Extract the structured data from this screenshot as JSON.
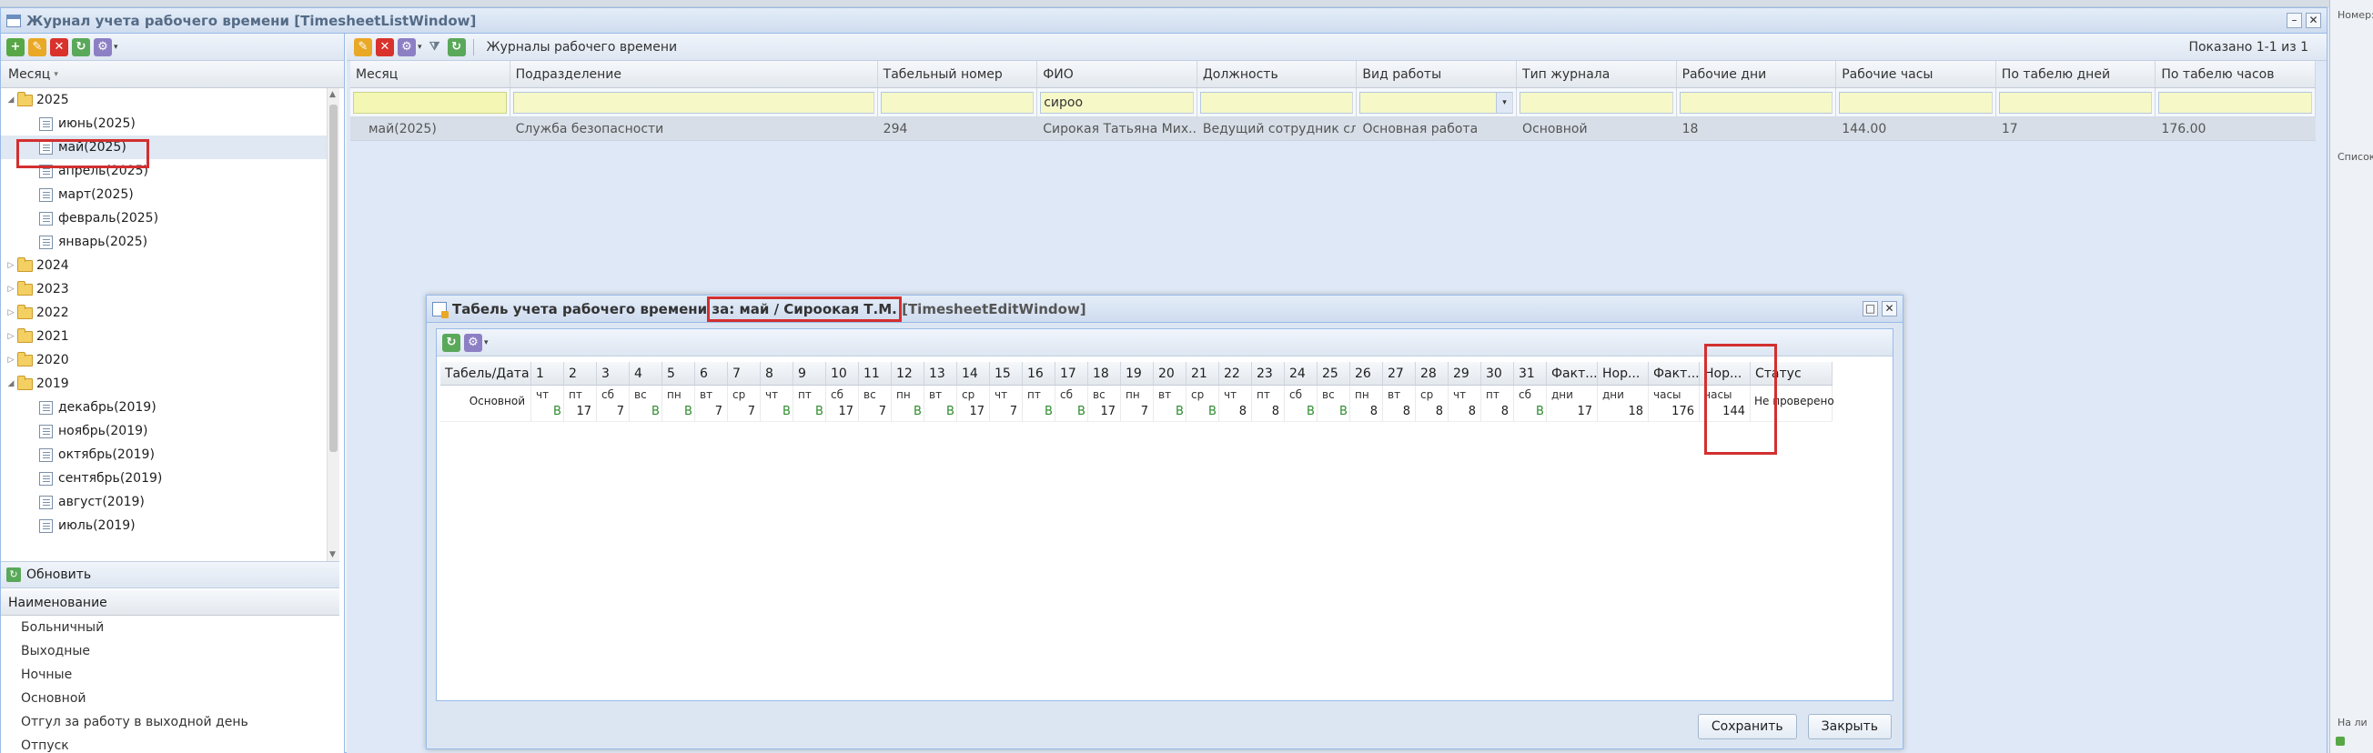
{
  "main_window": {
    "title": "Журнал учета рабочего времени [TimesheetListWindow]"
  },
  "left_panel": {
    "column_header": "Месяц",
    "tree": [
      {
        "label": "2025",
        "type": "year",
        "expanded": true
      },
      {
        "label": "июнь(2025)",
        "type": "month"
      },
      {
        "label": "май(2025)",
        "type": "month",
        "selected": true
      },
      {
        "label": "апрель(2025)",
        "type": "month"
      },
      {
        "label": "март(2025)",
        "type": "month"
      },
      {
        "label": "февраль(2025)",
        "type": "month"
      },
      {
        "label": "январь(2025)",
        "type": "month"
      },
      {
        "label": "2024",
        "type": "year",
        "expanded": false
      },
      {
        "label": "2023",
        "type": "year",
        "expanded": false
      },
      {
        "label": "2022",
        "type": "year",
        "expanded": false
      },
      {
        "label": "2021",
        "type": "year",
        "expanded": false
      },
      {
        "label": "2020",
        "type": "year",
        "expanded": false
      },
      {
        "label": "2019",
        "type": "year",
        "expanded": true
      },
      {
        "label": "декабрь(2019)",
        "type": "month"
      },
      {
        "label": "ноябрь(2019)",
        "type": "month"
      },
      {
        "label": "октябрь(2019)",
        "type": "month"
      },
      {
        "label": "сентябрь(2019)",
        "type": "month"
      },
      {
        "label": "август(2019)",
        "type": "month"
      },
      {
        "label": "июль(2019)",
        "type": "month"
      }
    ],
    "refresh_label": "Обновить",
    "names_header": "Наименование",
    "names": [
      "Больничный",
      "Выходные",
      "Ночные",
      "Основной",
      "Отгул за работу в выходной день",
      "Отпуск"
    ]
  },
  "right_panel": {
    "toolbar_label": "Журналы рабочего времени",
    "shown": "Показано 1-1 из 1",
    "columns": [
      "Месяц",
      "Подразделение",
      "Табельный номер",
      "ФИО",
      "Должность",
      "Вид работы",
      "Тип журнала",
      "Рабочие дни",
      "Рабочие часы",
      "По табелю дней",
      "По табелю часов"
    ],
    "filters": [
      "",
      "",
      "",
      "сироо",
      "",
      "",
      "",
      "",
      "",
      "",
      ""
    ],
    "rows": [
      [
        "май(2025)",
        "Служба безопасности",
        "294",
        "Сирокая Татьяна Мих...",
        "Ведущий сотрудник слу...",
        "Основная работа",
        "Основной",
        "18",
        "144.00",
        "17",
        "176.00"
      ]
    ]
  },
  "right_strip": {
    "label1": "Номер:",
    "label2": "Список",
    "label3": "На ли"
  },
  "modal": {
    "title_prefix": "Табель учета рабочего времени",
    "title_highlight": "за: май / Сироокая Т.М.",
    "title_suffix": "[TimesheetEditWindow]",
    "headers": [
      "Табель/Дата",
      "1",
      "2",
      "3",
      "4",
      "5",
      "6",
      "7",
      "8",
      "9",
      "10",
      "11",
      "12",
      "13",
      "14",
      "15",
      "16",
      "17",
      "18",
      "19",
      "20",
      "21",
      "22",
      "23",
      "24",
      "25",
      "26",
      "27",
      "28",
      "29",
      "30",
      "31",
      "Факт...",
      "Нор...",
      "Факт...",
      "Нор...",
      "Статус"
    ],
    "row_label": "Основной",
    "days": [
      {
        "wd": "чт",
        "v": "В"
      },
      {
        "wd": "пт",
        "v": "17"
      },
      {
        "wd": "сб",
        "v": "7"
      },
      {
        "wd": "вс",
        "v": "В"
      },
      {
        "wd": "пн",
        "v": "В"
      },
      {
        "wd": "вт",
        "v": "7"
      },
      {
        "wd": "ср",
        "v": "7"
      },
      {
        "wd": "чт",
        "v": "В"
      },
      {
        "wd": "пт",
        "v": "В"
      },
      {
        "wd": "сб",
        "v": "17"
      },
      {
        "wd": "вс",
        "v": "7"
      },
      {
        "wd": "пн",
        "v": "В"
      },
      {
        "wd": "вт",
        "v": "В"
      },
      {
        "wd": "ср",
        "v": "17"
      },
      {
        "wd": "чт",
        "v": "7"
      },
      {
        "wd": "пт",
        "v": "В"
      },
      {
        "wd": "сб",
        "v": "В"
      },
      {
        "wd": "вс",
        "v": "17"
      },
      {
        "wd": "пн",
        "v": "7"
      },
      {
        "wd": "вт",
        "v": "В"
      },
      {
        "wd": "ср",
        "v": "В"
      },
      {
        "wd": "чт",
        "v": "8"
      },
      {
        "wd": "пт",
        "v": "8"
      },
      {
        "wd": "сб",
        "v": "В"
      },
      {
        "wd": "вс",
        "v": "В"
      },
      {
        "wd": "пн",
        "v": "8"
      },
      {
        "wd": "вт",
        "v": "8"
      },
      {
        "wd": "ср",
        "v": "8"
      },
      {
        "wd": "чт",
        "v": "8"
      },
      {
        "wd": "пт",
        "v": "8"
      },
      {
        "wd": "сб",
        "v": "В"
      }
    ],
    "totals": [
      {
        "unit": "дни",
        "v": "17"
      },
      {
        "unit": "дни",
        "v": "18"
      },
      {
        "unit": "часы",
        "v": "176"
      },
      {
        "unit": "часы",
        "v": "144"
      }
    ],
    "status": "Не проверено",
    "save_label": "Сохранить",
    "close_label": "Закрыть"
  }
}
